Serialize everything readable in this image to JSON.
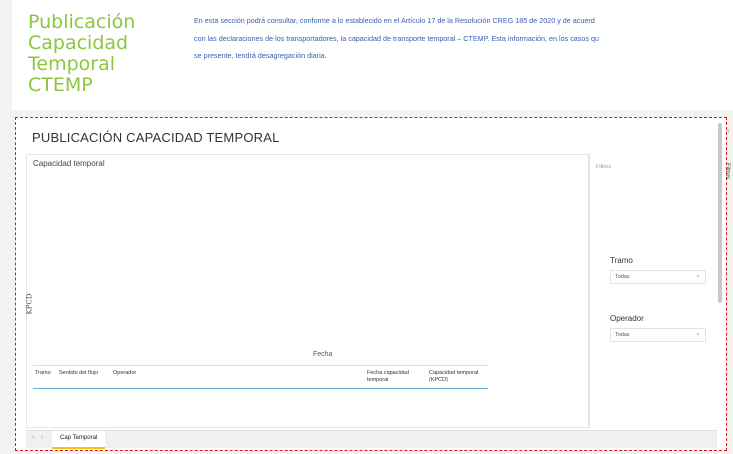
{
  "header": {
    "title": "Publicación Capacidad Temporal CTEMP",
    "intro_line1": "En esta sección podrá consultar, conforme a lo establecido en el Artículo 17 de la Resolución CREG 185 de 2020 y de acuerd",
    "intro_line2": "con las declaraciones de los transportadores, la capacidad de transporte temporal – CTEMP. Esta información, en los casos qu",
    "intro_line3": "se presente, tendrá desagregación diaria."
  },
  "report": {
    "title": "PUBLICACIÓN CAPACIDAD TEMPORAL",
    "chart_title": "Capacidad temporal",
    "y_axis_label": "KPCD",
    "x_axis_label": "Fecha",
    "table_columns": [
      "Tramo",
      "Sentido del flujo",
      "Operador",
      "Fecha capacidad temporal",
      "Capacidad temporal (KPCD)"
    ]
  },
  "filters": {
    "heading": "Filtros",
    "side_label": "Filtros",
    "tramo_title": "Tramo",
    "tramo_value": "Todas",
    "operador_title": "Operador",
    "operador_value": "Todas"
  },
  "tabs": {
    "active": "Cap Temporal"
  },
  "colors": {
    "title_green": "#8cc63f",
    "intro_blue": "#3a5fb0",
    "frame_red": "#e0161a",
    "tab_accent": "#f2c811"
  }
}
